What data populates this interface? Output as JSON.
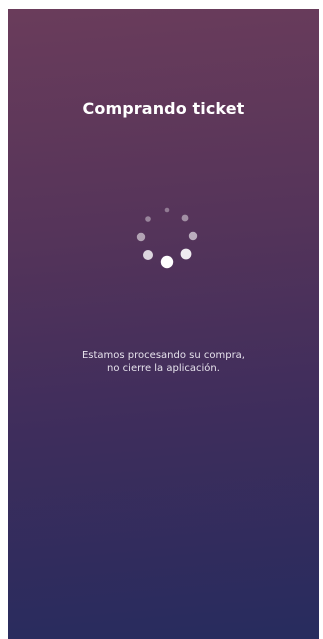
{
  "screen": {
    "title": "Comprando ticket",
    "message_line1": "Estamos procesando su compra,",
    "message_line2": "no cierre la aplicación.",
    "spinner_icon": "loading-spinner-icon"
  }
}
